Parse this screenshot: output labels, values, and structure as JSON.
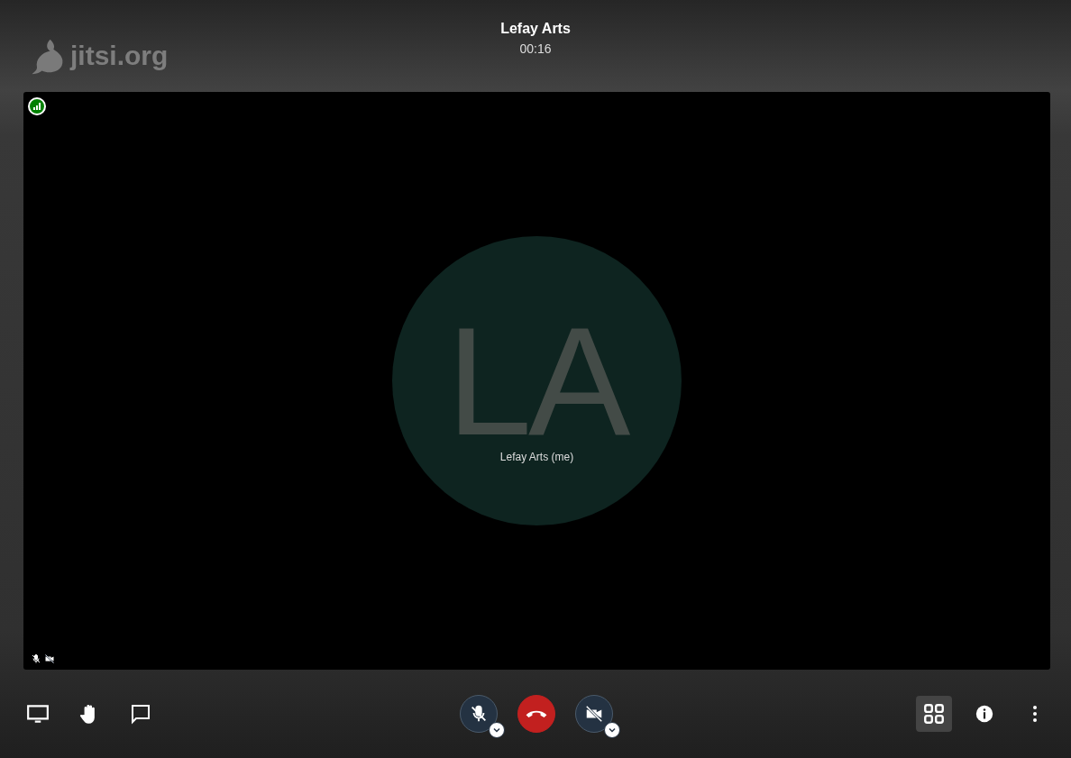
{
  "header": {
    "logo_text": "jitsi.org",
    "title": "Lefay Arts",
    "timer": "00:16"
  },
  "tile": {
    "initials": "LA",
    "display_name": "Lefay Arts (me)",
    "audio_muted": true,
    "video_muted": true
  },
  "toolbar": {
    "left": [
      {
        "kind": "screenshare"
      },
      {
        "kind": "raisehand"
      },
      {
        "kind": "chat"
      }
    ],
    "center": [
      {
        "kind": "mic",
        "muted": true
      },
      {
        "kind": "hangup"
      },
      {
        "kind": "camera",
        "muted": true
      }
    ],
    "right": [
      {
        "kind": "tileview",
        "selected": true
      },
      {
        "kind": "info",
        "selected": false
      },
      {
        "kind": "more",
        "selected": false
      }
    ]
  }
}
